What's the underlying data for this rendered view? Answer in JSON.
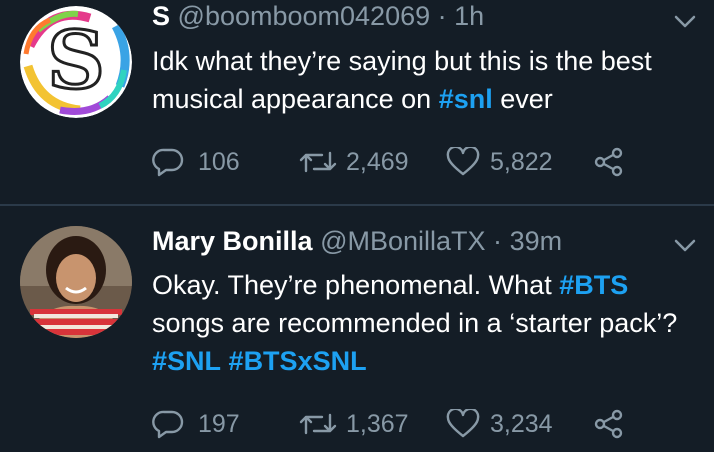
{
  "tweets": [
    {
      "display_name": "S",
      "handle": "@boomboom042069",
      "separator": "·",
      "time": "1h",
      "text_parts": [
        {
          "t": "Idk what they’re saying but this is the best musical appearance on ",
          "tag": false
        },
        {
          "t": "#snl",
          "tag": true
        },
        {
          "t": " ever",
          "tag": false
        }
      ],
      "replies": "106",
      "retweets": "2,469",
      "likes": "5,822"
    },
    {
      "display_name": "Mary Bonilla",
      "handle": "@MBonillaTX",
      "separator": "·",
      "time": "39m",
      "text_parts": [
        {
          "t": "Okay. They’re phenomenal. What ",
          "tag": false
        },
        {
          "t": "#BTS",
          "tag": true
        },
        {
          "t": " songs are recommended in a ‘starter pack’? ",
          "tag": false
        },
        {
          "t": "#SNL",
          "tag": true
        },
        {
          "t": " ",
          "tag": false
        },
        {
          "t": "#BTSxSNL",
          "tag": true
        }
      ],
      "replies": "197",
      "retweets": "1,367",
      "likes": "3,234"
    }
  ],
  "colors": {
    "background": "#141d26",
    "muted": "#8899a6",
    "link": "#1da1f2",
    "divider": "#2b3a49"
  },
  "icons": [
    "reply-icon",
    "retweet-icon",
    "like-icon",
    "share-icon",
    "chevron-down-icon"
  ]
}
